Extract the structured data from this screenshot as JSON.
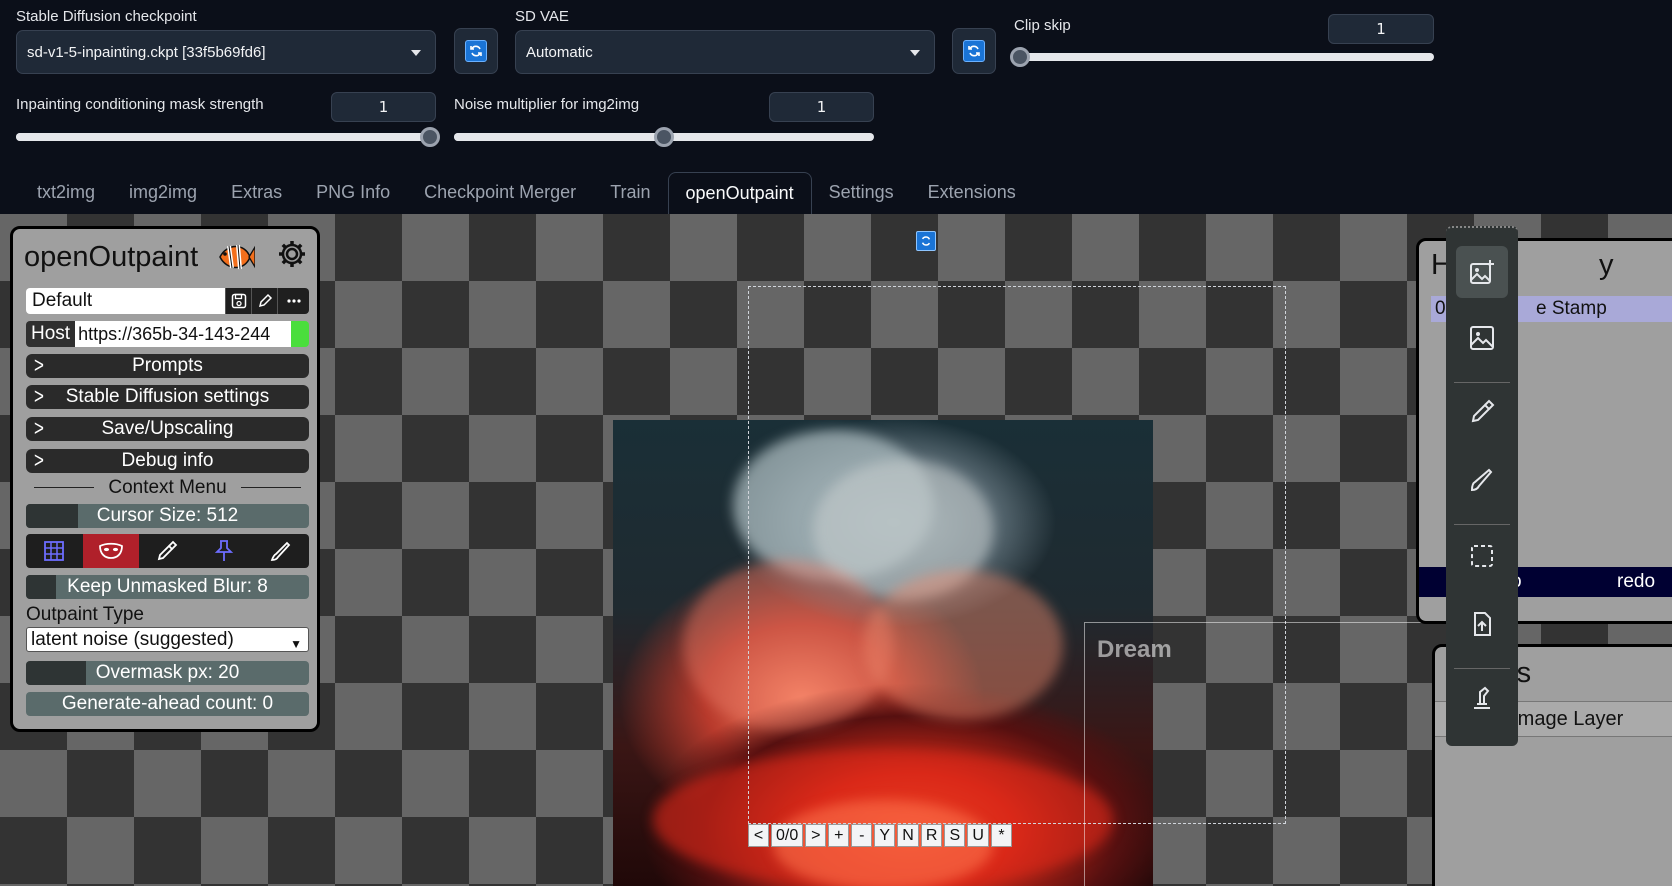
{
  "settings": {
    "checkpoint_label": "Stable Diffusion checkpoint",
    "checkpoint_value": "sd-v1-5-inpainting.ckpt [33f5b69fd6]",
    "vae_label": "SD VAE",
    "vae_value": "Automatic",
    "clip_skip_label": "Clip skip",
    "clip_skip_value": "1",
    "clip_skip_fraction": 0,
    "mask_strength_label": "Inpainting conditioning mask strength",
    "mask_strength_value": "1",
    "mask_strength_fraction": 1,
    "noise_mult_label": "Noise multiplier for img2img",
    "noise_mult_value": "1",
    "noise_mult_fraction": 0.5
  },
  "tabs": [
    "txt2img",
    "img2img",
    "Extras",
    "PNG Info",
    "Checkpoint Merger",
    "Train",
    "openOutpaint",
    "Settings",
    "Extensions"
  ],
  "active_tab": "openOutpaint",
  "panel": {
    "title": "openOutpaint",
    "profile": "Default",
    "host_label": "Host",
    "host_value": "https://365b-34-143-244",
    "accordions": [
      "Prompts",
      "Stable Diffusion settings",
      "Save/Upscaling",
      "Debug info"
    ],
    "context_menu": "Context Menu",
    "cursor_size": "Cursor Size: 512",
    "keep_blur": "Keep Unmasked Blur: 8",
    "outpaint_type_label": "Outpaint Type",
    "outpaint_type_value": "latent noise (suggested)",
    "overmask": "Overmask px: 20",
    "generate_ahead": "Generate-ahead count: 0"
  },
  "canvas": {
    "dream_label": "Dream",
    "nav": [
      "<",
      "0/0",
      ">",
      "+",
      "-",
      "Y",
      "N",
      "R",
      "S",
      "U",
      "*"
    ]
  },
  "history": {
    "title_fragment": "H",
    "title_end": "y",
    "item": "e Stamp",
    "item_prefix": "0",
    "undo_fragment": "o",
    "redo": "redo"
  },
  "layers": {
    "title_fragment": "rs",
    "item": ": Image Layer"
  },
  "colors": {
    "accent_blue": "#1a74d6",
    "active_tool": "#b0202a",
    "host_ok": "#4ade3c"
  }
}
